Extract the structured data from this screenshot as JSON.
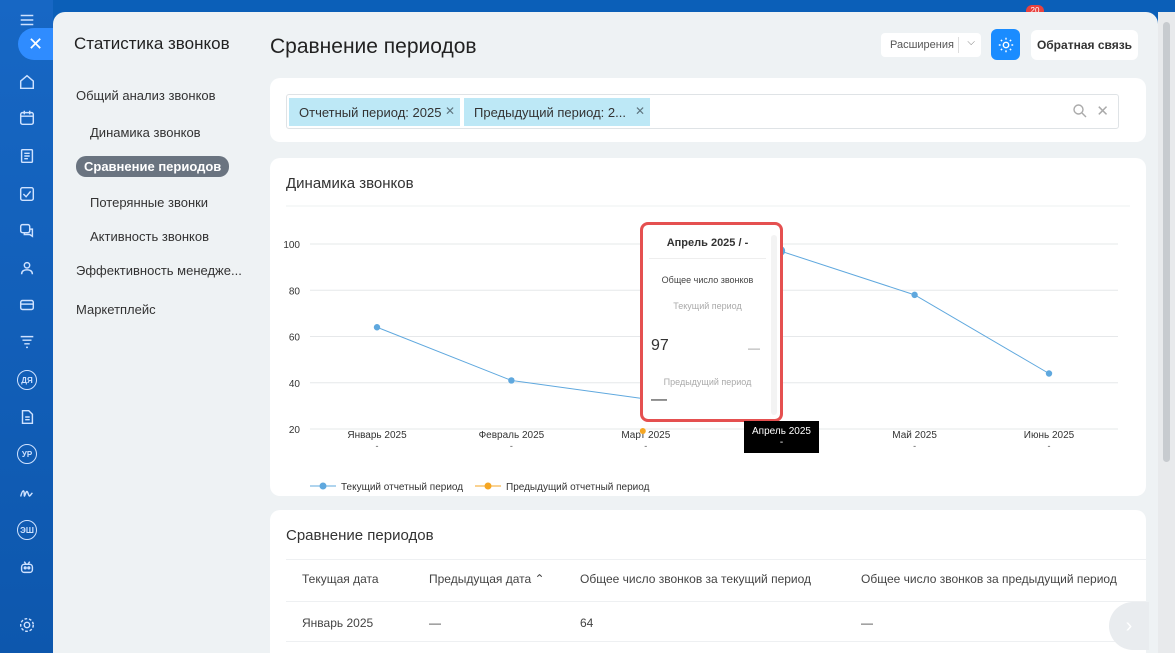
{
  "sidebar": {
    "title": "Статистика звонков",
    "items": [
      {
        "label": "Общий анализ звонков"
      },
      {
        "label": "Динамика звонков"
      },
      {
        "label": "Сравнение периодов"
      },
      {
        "label": "Потерянные звонки"
      },
      {
        "label": "Активность звонков"
      },
      {
        "label": "Эффективность менедже..."
      },
      {
        "label": "Маркетплейс"
      }
    ]
  },
  "rail": {
    "badges": [
      "ДЯ",
      "УР",
      "ЭШ"
    ],
    "notification": "20"
  },
  "header": {
    "title": "Сравнение периодов",
    "extensions_label": "Расширения",
    "feedback_label": "Обратная связь"
  },
  "filter": {
    "chips": [
      "Отчетный период: 2025",
      "Предыдущий период: 2..."
    ]
  },
  "chart_card": {
    "title": "Динамика звонков"
  },
  "chart_data": {
    "type": "line",
    "title": "Динамика звонков",
    "categories": [
      "Январь 2025",
      "Февраль 2025",
      "Март 2025",
      "Апрель 2025",
      "Май 2025",
      "Июнь 2025"
    ],
    "category_sub": [
      "-",
      "-",
      "-",
      "-",
      "-",
      "-"
    ],
    "series": [
      {
        "name": "Текущий отчетный период",
        "values": [
          64,
          41,
          33,
          97,
          78,
          44
        ],
        "color": "#5fa8de"
      },
      {
        "name": "Предыдущий отчетный период",
        "values": [],
        "color": "#f5a623"
      }
    ],
    "yticks": [
      20,
      40,
      60,
      80,
      100
    ],
    "ylim": [
      20,
      100
    ],
    "grid": true,
    "legend": "bottom-left"
  },
  "tooltip": {
    "title": "Апрель 2025 / -",
    "metric": "Общее число звонков",
    "current_label": "Текущий период",
    "current_value": "97",
    "current_dash": "—",
    "previous_label": "Предыдущий период",
    "previous_value": "—"
  },
  "table": {
    "title": "Сравнение периодов",
    "columns": [
      "Текущая дата",
      "Предыдущая дата ⌃",
      "Общее число звонков за текущий период",
      "Общее число звонков за предыдущий период"
    ],
    "rows": [
      [
        "Январь 2025",
        "—",
        "64",
        "—"
      ]
    ]
  },
  "colors": {
    "accent": "#1a8cff",
    "chip": "#bde8f6",
    "tooltip_border": "#e55050"
  }
}
